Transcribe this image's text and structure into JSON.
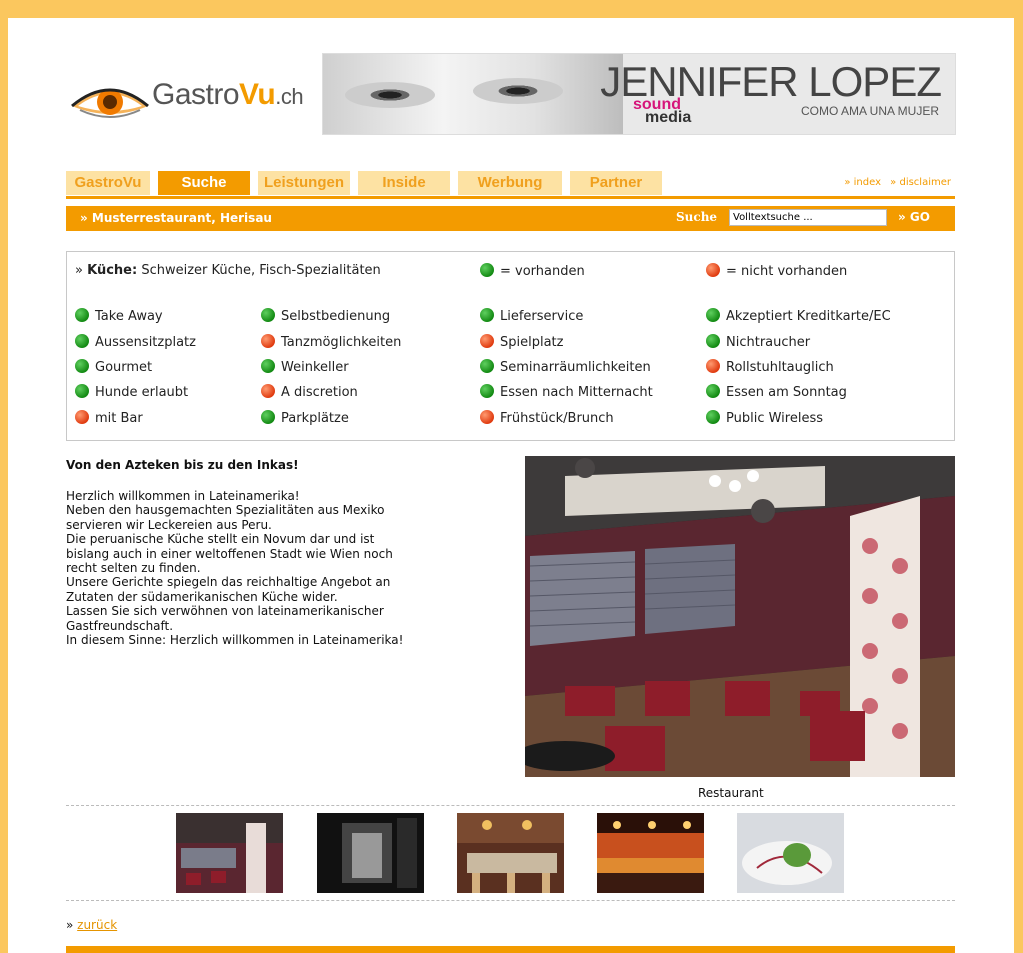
{
  "logo": {
    "brand": "Gastro",
    "brand_accent": "Vu",
    "domain": ".ch"
  },
  "banner": {
    "title": "JENNIFER LOPEZ",
    "subtitle": "COMO AMA UNA MUJER",
    "label_1": "sound",
    "label_2": "media"
  },
  "nav": {
    "tabs": [
      "GastroVu",
      "Suche",
      "Leistungen",
      "Inside",
      "Werbung",
      "Partner"
    ],
    "active_tab": "Suche",
    "links": [
      "» index",
      "» disclaimer"
    ]
  },
  "breadcrumb": "» Musterrestaurant, Herisau",
  "search": {
    "label": "Suche",
    "value": "Volltextsuche ...",
    "go": "» GO"
  },
  "kueche": {
    "prefix": "» ",
    "label": "Küche:",
    "value": "Schweizer Küche, Fisch-Spezialitäten"
  },
  "legend": {
    "available": "= vorhanden",
    "unavailable": "= nicht vorhanden"
  },
  "features": [
    [
      "Take Away",
      "Selbstbedienung",
      "Lieferservice",
      "Akzeptiert Kreditkarte/EC"
    ],
    [
      "Aussensitzplatz",
      "Tanzmöglichkeiten",
      "Spielplatz",
      "Nichtraucher"
    ],
    [
      "Gourmet",
      "Weinkeller",
      "Seminarräumlichkeiten",
      "Rollstuhltauglich"
    ],
    [
      "Hunde erlaubt",
      "A discretion",
      "Essen nach Mitternacht",
      "Essen am Sonntag"
    ],
    [
      "mit Bar",
      "Parkplätze",
      "Frühstück/Brunch",
      "Public Wireless"
    ]
  ],
  "feature_status": [
    [
      "available",
      "available",
      "available",
      "available"
    ],
    [
      "available",
      "unavailable",
      "unavailable",
      "available"
    ],
    [
      "available",
      "available",
      "available",
      "unavailable"
    ],
    [
      "available",
      "unavailable",
      "available",
      "available"
    ],
    [
      "unavailable",
      "available",
      "unavailable",
      "available"
    ]
  ],
  "colors": {
    "accent": "#f39b00",
    "available": "#1e9a1e",
    "unavailable": "#e5461a",
    "page_bg": "#fbc75e"
  },
  "content": {
    "title": "Von den Azteken bis zu den Inkas!",
    "lines": [
      "Herzlich willkommen in Lateinamerika!",
      "Neben den hausgemachten Spezialitäten aus Mexiko",
      "servieren wir Leckereien aus Peru.",
      "Die peruanische Küche stellt ein Novum dar und ist",
      "bislang auch in einer weltoffenen Stadt wie Wien noch",
      "recht selten zu finden.",
      "Unsere Gerichte spiegeln das reichhaltige Angebot an",
      "Zutaten der südamerikanischen Küche wider.",
      "Lassen Sie sich verwöhnen von lateinamerikanischer",
      "Gastfreundschaft.",
      "In diesem Sinne: Herzlich willkommen in Lateinamerika!"
    ]
  },
  "image_caption": "Restaurant",
  "thumbnails": [
    "restaurant-interior-thumbnail",
    "restaurant-dark-interior-thumbnail",
    "restaurant-dining-thumbnail",
    "restaurant-bar-thumbnail",
    "dish-plate-thumbnail"
  ],
  "back_link": {
    "prefix": "» ",
    "label": "zurück"
  }
}
